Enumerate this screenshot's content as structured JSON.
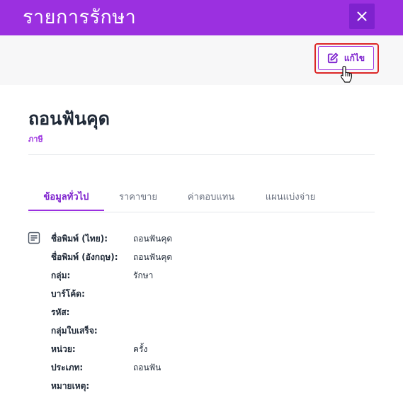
{
  "header": {
    "title": "รายการรักษา"
  },
  "toolbar": {
    "edit_label": "แก้ไข"
  },
  "item": {
    "title": "ถอนฟันคุด",
    "subtitle": "ภาษี"
  },
  "tabs": [
    {
      "label": "ข้อมูลทั่วไป",
      "active": true
    },
    {
      "label": "ราคาขาย",
      "active": false
    },
    {
      "label": "ค่าตอบแทน",
      "active": false
    },
    {
      "label": "แผนแบ่งจ่าย",
      "active": false
    }
  ],
  "details": [
    {
      "label": "ชื่อพิมพ์ (ไทย):",
      "value": "ถอนฟันคุด"
    },
    {
      "label": "ชื่อพิมพ์ (อังกฤษ):",
      "value": "ถอนฟันคุด"
    },
    {
      "label": "กลุ่ม:",
      "value": "รักษา"
    },
    {
      "label": "บาร์โค้ด:",
      "value": ""
    },
    {
      "label": "รหัส:",
      "value": ""
    },
    {
      "label": "กลุ่มใบเสร็จ:",
      "value": ""
    },
    {
      "label": "หน่วย:",
      "value": "ครั้ง"
    },
    {
      "label": "ประเภท:",
      "value": "ถอนฟัน"
    },
    {
      "label": "หมายเหตุ:",
      "value": ""
    }
  ],
  "colors": {
    "brand": "#9b30e0",
    "brand_dark": "#7e22ce",
    "highlight": "#dc2626",
    "toolbar_bg": "#f7f7f8"
  },
  "icons": {
    "close": "close-icon",
    "edit": "edit-icon",
    "details": "document-list-icon",
    "cursor": "hand-pointer-cursor"
  }
}
